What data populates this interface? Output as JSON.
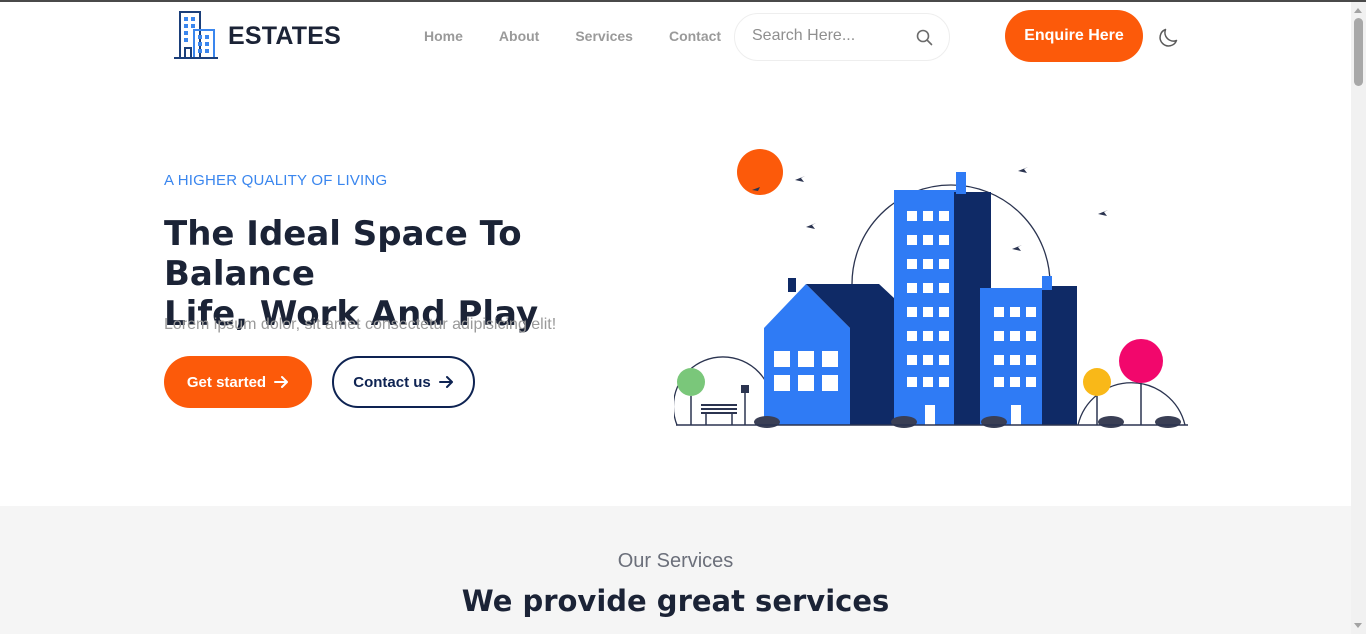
{
  "brand": {
    "name": "ESTATES"
  },
  "nav": {
    "items": [
      "Home",
      "About",
      "Services",
      "Contact"
    ]
  },
  "search": {
    "placeholder": "Search Here..."
  },
  "header": {
    "cta_label": "Enquire Here"
  },
  "hero": {
    "eyebrow": "A HIGHER QUALITY OF LIVING",
    "title_line1": "The Ideal Space To Balance",
    "title_line2": "Life, Work And Play",
    "subtitle": "Lorem ipsum dolor, sit amet consectetur adipisicing elit!",
    "primary_button": "Get started",
    "secondary_button": "Contact us"
  },
  "services": {
    "eyebrow": "Our Services",
    "title": "We provide great services"
  },
  "colors": {
    "accent": "#fc5a0a",
    "eyebrow_blue": "#3a86ee",
    "dark_navy": "#0e2352",
    "text_dark": "#1b2336",
    "muted": "#9a9a9a",
    "section_bg": "#f5f5f5"
  },
  "icons": {
    "logo": "building-icon",
    "search": "search-icon",
    "theme": "moon-icon",
    "arrow": "arrow-right-icon"
  }
}
